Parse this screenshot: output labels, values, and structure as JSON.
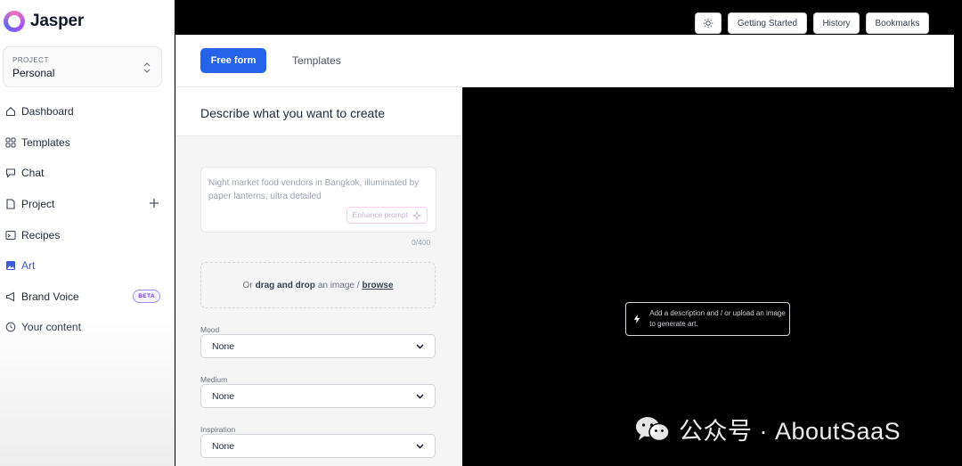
{
  "app": {
    "name": "Jasper"
  },
  "project": {
    "label": "PROJECT",
    "name": "Personal"
  },
  "sidebar": {
    "items": [
      {
        "label": "Dashboard",
        "icon": "home-icon"
      },
      {
        "label": "Templates",
        "icon": "grid-icon"
      },
      {
        "label": "Chat",
        "icon": "chat-icon"
      },
      {
        "label": "Project",
        "icon": "file-icon"
      },
      {
        "label": "Recipes",
        "icon": "terminal-icon"
      },
      {
        "label": "Art",
        "icon": "image-icon",
        "active": true
      },
      {
        "label": "Brand Voice",
        "icon": "megaphone-icon",
        "badge": "BETA"
      },
      {
        "label": "Your content",
        "icon": "content-icon"
      }
    ]
  },
  "topbar": {
    "getting_started": "Getting Started",
    "history": "History",
    "bookmarks": "Bookmarks"
  },
  "tabs": {
    "free_form": "Free form",
    "templates": "Templates"
  },
  "form": {
    "title": "Describe what you want to create",
    "prompt_placeholder": "Night market food vendors in Bangkok, illuminated by paper lanterns, ultra detailed",
    "enhance_label": "Enhance prompt",
    "char_count": "0/400",
    "upload": {
      "prefix": "Or",
      "drag": "drag and drop",
      "middle": "an image /",
      "browse": "browse"
    },
    "mood": {
      "label": "Mood",
      "value": "None"
    },
    "medium": {
      "label": "Medium",
      "value": "None"
    },
    "inspiration": {
      "label": "Inspiration",
      "value": "None"
    }
  },
  "preview": {
    "hint": "Add a description and / or upload an image to generate art."
  },
  "watermark": {
    "text": "公众号 · AboutSaaS"
  },
  "colors": {
    "accent": "#2563eb",
    "active_nav": "#3b5bdb",
    "beta": "#7c3aed"
  }
}
